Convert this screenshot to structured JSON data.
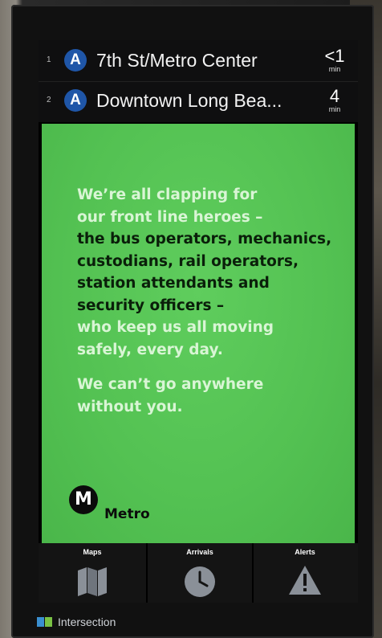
{
  "arrivals": [
    {
      "index": "1",
      "line": "A",
      "destination": "7th St/Metro Center",
      "time": "<1",
      "unit": "min"
    },
    {
      "index": "2",
      "line": "A",
      "destination": "Downtown Long Bea...",
      "time": "4",
      "unit": "min"
    }
  ],
  "message": {
    "lines": [
      {
        "text": "We’re all clapping for",
        "tone": "light"
      },
      {
        "text": "our front line heroes –",
        "tone": "light"
      },
      {
        "text": "the bus operators, mechanics,",
        "tone": "dark"
      },
      {
        "text": "custodians, rail operators,",
        "tone": "dark"
      },
      {
        "text": "station attendants and",
        "tone": "dark"
      },
      {
        "text": "security officers –",
        "tone": "dark"
      },
      {
        "text": "who keep us all moving",
        "tone": "light"
      },
      {
        "text": "safely, every day.",
        "tone": "light"
      }
    ],
    "closing": [
      "We can’t go anywhere",
      "without you."
    ]
  },
  "logo": {
    "mark": "M",
    "word": "Metro"
  },
  "tabs": [
    {
      "label": "Maps",
      "icon": "map-icon"
    },
    {
      "label": "Arrivals",
      "icon": "clock-icon"
    },
    {
      "label": "Alerts",
      "icon": "alert-icon"
    }
  ],
  "footer": {
    "brand": "Intersection"
  },
  "colors": {
    "panel": "#53c152",
    "line_badge": "#1f56a8",
    "light_text": "#d9f5d5",
    "dark_text": "#0a1f0a"
  }
}
